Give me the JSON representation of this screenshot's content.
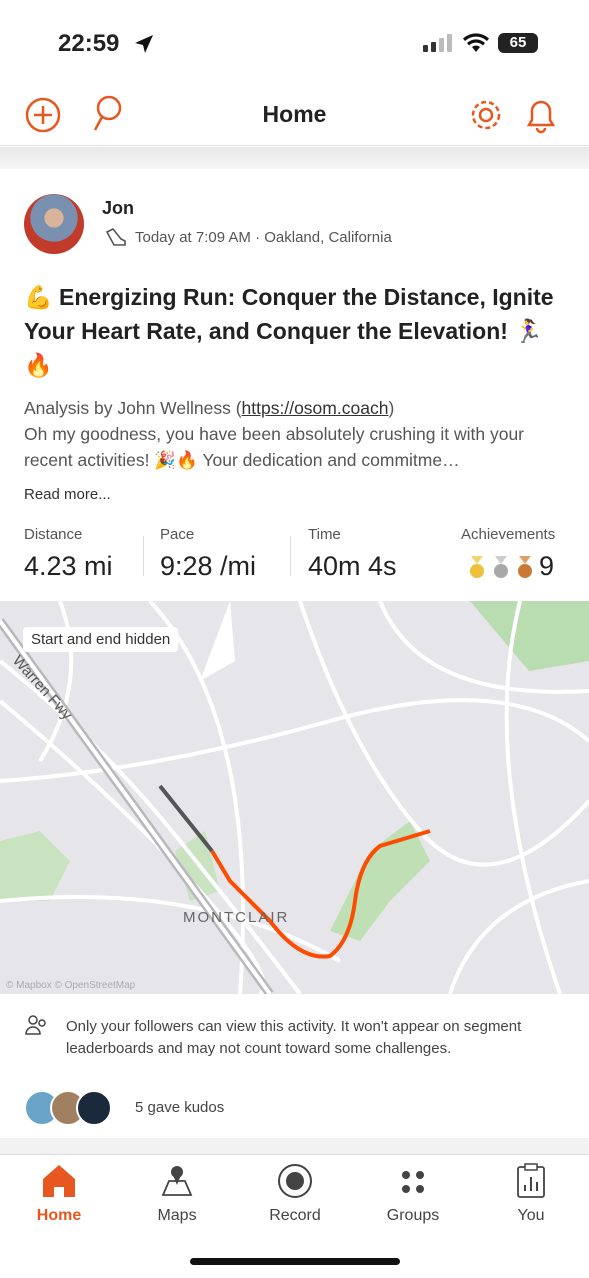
{
  "status_bar": {
    "time": "22:59",
    "battery": "65"
  },
  "header": {
    "title": "Home"
  },
  "activity": {
    "athlete": "Jon",
    "meta": "Today at 7:09 AM · Oakland, California",
    "title": "💪 Energizing Run: Conquer the Distance, Ignite Your Heart Rate, and Conquer the Elevation! 🏃‍♀️🔥",
    "desc_prefix": "Analysis by John Wellness (",
    "desc_link": "https://osom.coach",
    "desc_suffix": ")",
    "desc_body": "Oh my goodness, you have been absolutely crushing it with your recent activities! 🎉🔥 Your dedication and commitme…",
    "read_more": "Read more...",
    "stats": [
      {
        "label": "Distance",
        "value": "4.23 mi"
      },
      {
        "label": "Pace",
        "value": "9:28 /mi"
      },
      {
        "label": "Time",
        "value": "40m 4s"
      },
      {
        "label": "Achievements",
        "value": "9"
      }
    ],
    "map": {
      "hidden_label": "Start and end hidden",
      "road_label": "Warren Fwy",
      "place_label": "MONTCLAIR",
      "attribution": "© Mapbox © OpenStreetMap",
      "route_color": "#fc4c02"
    },
    "privacy": "Only your followers can view this activity. It won't appear on segment leaderboards and may not count toward some challenges.",
    "kudos": "5 gave kudos"
  },
  "tabs": [
    {
      "label": "Home",
      "active": true
    },
    {
      "label": "Maps"
    },
    {
      "label": "Record"
    },
    {
      "label": "Groups"
    },
    {
      "label": "You"
    }
  ],
  "colors": {
    "accent": "#e8571f"
  }
}
